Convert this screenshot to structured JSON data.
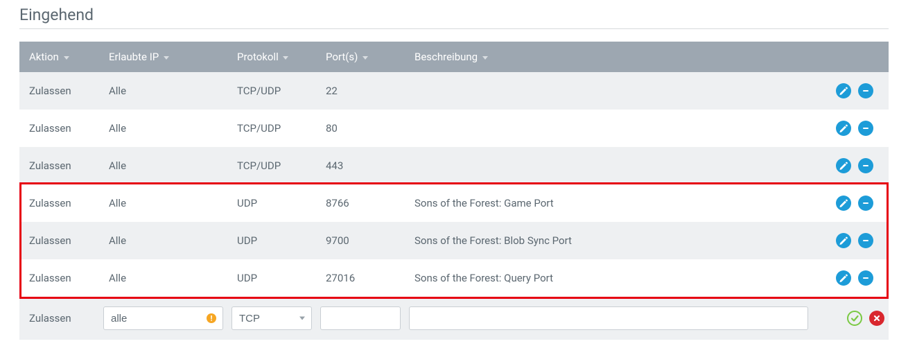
{
  "section_title": "Eingehend",
  "columns": {
    "aktion": "Aktion",
    "ip": "Erlaubte IP",
    "protokoll": "Protokoll",
    "ports": "Port(s)",
    "beschreibung": "Beschreibung"
  },
  "rows": [
    {
      "aktion": "Zulassen",
      "ip": "Alle",
      "protokoll": "TCP/UDP",
      "ports": "22",
      "beschreibung": ""
    },
    {
      "aktion": "Zulassen",
      "ip": "Alle",
      "protokoll": "TCP/UDP",
      "ports": "80",
      "beschreibung": ""
    },
    {
      "aktion": "Zulassen",
      "ip": "Alle",
      "protokoll": "TCP/UDP",
      "ports": "443",
      "beschreibung": ""
    },
    {
      "aktion": "Zulassen",
      "ip": "Alle",
      "protokoll": "UDP",
      "ports": "8766",
      "beschreibung": "Sons of the Forest: Game Port"
    },
    {
      "aktion": "Zulassen",
      "ip": "Alle",
      "protokoll": "UDP",
      "ports": "9700",
      "beschreibung": "Sons of the Forest: Blob Sync Port"
    },
    {
      "aktion": "Zulassen",
      "ip": "Alle",
      "protokoll": "UDP",
      "ports": "27016",
      "beschreibung": "Sons of the Forest: Query Port"
    }
  ],
  "highlight": {
    "from_row": 3,
    "to_row": 5
  },
  "new_row": {
    "aktion": "Zulassen",
    "ip_value": "alle",
    "protokoll_value": "TCP",
    "ports_value": "",
    "beschreibung_value": ""
  },
  "colors": {
    "primary": "#1d9cd8",
    "danger": "#d9272e",
    "success": "#7ac943",
    "warning": "#f6a623",
    "highlight_border": "#e60012"
  }
}
